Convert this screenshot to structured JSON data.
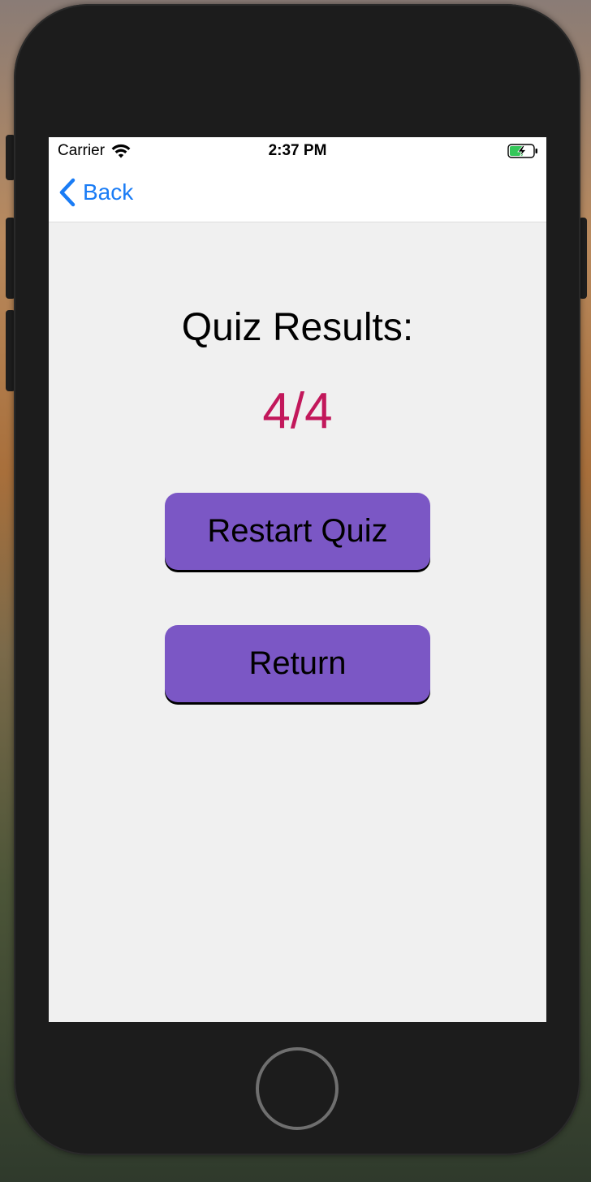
{
  "status_bar": {
    "carrier": "Carrier",
    "time": "2:37 PM",
    "wifi_icon": "wifi-icon",
    "battery_icon": "battery-charging-icon",
    "battery_color": "#34c759"
  },
  "nav": {
    "back_label": "Back",
    "back_icon": "chevron-left-icon",
    "accent_color": "#1a7cf5"
  },
  "results": {
    "title": "Quiz Results:",
    "score": "4/4",
    "score_color": "#c2185b"
  },
  "actions": {
    "restart_label": "Restart Quiz",
    "return_label": "Return",
    "button_color": "#7b57c5"
  }
}
